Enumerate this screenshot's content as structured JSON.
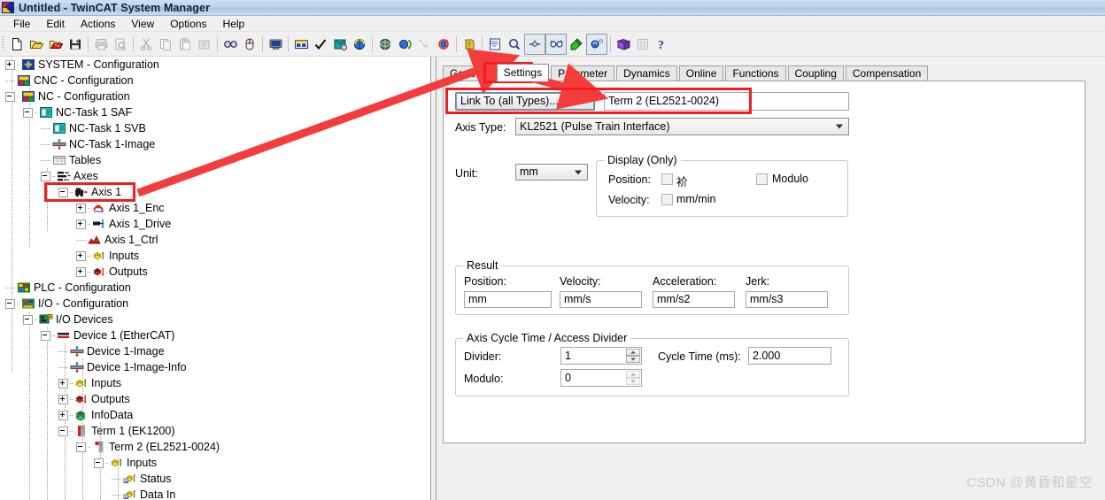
{
  "window": {
    "title": "Untitled - TwinCAT System Manager",
    "app_icon": "twincat-icon"
  },
  "menu": {
    "items": [
      "File",
      "Edit",
      "Actions",
      "View",
      "Options",
      "Help"
    ]
  },
  "toolbar": {
    "groups": [
      {
        "icons": [
          "new-document-icon",
          "open-folder-icon",
          "open-project-icon",
          "save-icon"
        ]
      },
      {
        "icons": [
          "print-icon",
          "print-preview-icon"
        ]
      },
      {
        "icons": [
          "cut-icon",
          "copy-icon",
          "paste-icon",
          "paste-special-icon"
        ]
      },
      {
        "icons": [
          "find-icon",
          "mouse-select-icon"
        ]
      },
      {
        "icons": [
          "choose-target-system-icon"
        ]
      },
      {
        "icons": [
          "show-online-data-icon",
          "check-configuration-icon",
          "activate-configuration-icon",
          "restart-twincat-icon"
        ]
      },
      {
        "icons": [
          "reload-devices-icon",
          "scan-devices-icon",
          "toggle-free-run-icon"
        ]
      },
      {
        "icons": [
          "magic-wand-icon",
          "reload-io-devices-icon"
        ]
      },
      {
        "icons": [
          "append-box-icon"
        ]
      },
      {
        "icons": [
          "edit-list-icon",
          "zoom-icon",
          "link-variable-icon",
          "show-links-icon",
          "online-write-icon",
          "change-id-icon"
        ]
      },
      {
        "icons": [
          "documentation-icon",
          "export-icon",
          "help-icon"
        ]
      }
    ]
  },
  "tree": {
    "nodes": [
      {
        "label": "SYSTEM - Configuration",
        "indent": 0,
        "toggle": "plus",
        "icon": "system-config-icon"
      },
      {
        "label": "CNC - Configuration",
        "indent": 0,
        "toggle": "none",
        "icon": "cnc-config-icon"
      },
      {
        "label": "NC - Configuration",
        "indent": 0,
        "toggle": "minus",
        "icon": "nc-config-icon"
      },
      {
        "label": "NC-Task 1 SAF",
        "indent": 1,
        "toggle": "minus",
        "icon": "task-icon"
      },
      {
        "label": "NC-Task 1 SVB",
        "indent": 2,
        "toggle": "none",
        "icon": "task-icon"
      },
      {
        "label": "NC-Task 1-Image",
        "indent": 2,
        "toggle": "none",
        "icon": "image-icon"
      },
      {
        "label": "Tables",
        "indent": 2,
        "toggle": "none",
        "icon": "tables-icon"
      },
      {
        "label": "Axes",
        "indent": 2,
        "toggle": "minus",
        "icon": "axes-icon"
      },
      {
        "label": "Axis 1",
        "indent": 3,
        "toggle": "minus",
        "icon": "axis-icon",
        "highlighted": true
      },
      {
        "label": "Axis 1_Enc",
        "indent": 4,
        "toggle": "plus",
        "icon": "encoder-icon"
      },
      {
        "label": "Axis 1_Drive",
        "indent": 4,
        "toggle": "plus",
        "icon": "drive-icon"
      },
      {
        "label": "Axis 1_Ctrl",
        "indent": 4,
        "toggle": "none",
        "icon": "ctrl-icon"
      },
      {
        "label": "Inputs",
        "indent": 4,
        "toggle": "plus",
        "icon": "inputs-icon"
      },
      {
        "label": "Outputs",
        "indent": 4,
        "toggle": "plus",
        "icon": "outputs-icon"
      },
      {
        "label": "PLC - Configuration",
        "indent": 0,
        "toggle": "none",
        "icon": "plc-config-icon"
      },
      {
        "label": "I/O - Configuration",
        "indent": 0,
        "toggle": "minus",
        "icon": "io-config-icon"
      },
      {
        "label": "I/O Devices",
        "indent": 1,
        "toggle": "minus",
        "icon": "io-devices-icon"
      },
      {
        "label": "Device 1 (EtherCAT)",
        "indent": 2,
        "toggle": "minus",
        "icon": "ethercat-device-icon"
      },
      {
        "label": "Device 1-Image",
        "indent": 3,
        "toggle": "none",
        "icon": "image-icon"
      },
      {
        "label": "Device 1-Image-Info",
        "indent": 3,
        "toggle": "none",
        "icon": "image-icon"
      },
      {
        "label": "Inputs",
        "indent": 3,
        "toggle": "plus",
        "icon": "inputs-icon"
      },
      {
        "label": "Outputs",
        "indent": 3,
        "toggle": "plus",
        "icon": "outputs-icon"
      },
      {
        "label": "InfoData",
        "indent": 3,
        "toggle": "plus",
        "icon": "infodata-icon"
      },
      {
        "label": "Term 1 (EK1200)",
        "indent": 3,
        "toggle": "minus",
        "icon": "coupler-icon"
      },
      {
        "label": "Term 2 (EL2521-0024)",
        "indent": 4,
        "toggle": "minus",
        "icon": "terminal-icon"
      },
      {
        "label": "Inputs",
        "indent": 5,
        "toggle": "minus",
        "icon": "inputs-icon"
      },
      {
        "label": "Status",
        "indent": 6,
        "toggle": "none",
        "icon": "variable-in-icon"
      },
      {
        "label": "Data In",
        "indent": 6,
        "toggle": "none",
        "icon": "variable-in-icon"
      }
    ]
  },
  "tabs": {
    "items": [
      "General",
      "Settings",
      "Parameter",
      "Dynamics",
      "Online",
      "Functions",
      "Coupling",
      "Compensation"
    ],
    "active": "Settings"
  },
  "settings": {
    "link_button_label": "Link To (all Types)...",
    "linked_value": "Term 2 (EL2521-0024)",
    "axis_type_label": "Axis Type:",
    "axis_type_value": "KL2521 (Pulse Train Interface)",
    "unit_label": "Unit:",
    "unit_value": "mm",
    "display_group": {
      "title": "Display (Only)",
      "position_label": "Position:",
      "position_checkbox_label": "衸",
      "position_checked": false,
      "modulo_label": "Modulo",
      "modulo_checked": false,
      "velocity_label": "Velocity:",
      "velocity_checkbox_label": "mm/min",
      "velocity_checked": false
    },
    "result_group": {
      "title": "Result",
      "fields": [
        {
          "label": "Position:",
          "value": "mm"
        },
        {
          "label": "Velocity:",
          "value": "mm/s"
        },
        {
          "label": "Acceleration:",
          "value": "mm/s2"
        },
        {
          "label": "Jerk:",
          "value": "mm/s3"
        }
      ]
    },
    "cycle_group": {
      "title": "Axis Cycle Time / Access Divider",
      "divider_label": "Divider:",
      "divider_value": "1",
      "modulo_label": "Modulo:",
      "modulo_value": "0",
      "cycle_time_label": "Cycle Time (ms):",
      "cycle_time_value": "2.000"
    }
  },
  "annotations": {
    "highlight_color": "#f21d1d",
    "arrow_color": "#f53c3c"
  },
  "watermark": {
    "text": "CSDN @黄昏和星空"
  }
}
